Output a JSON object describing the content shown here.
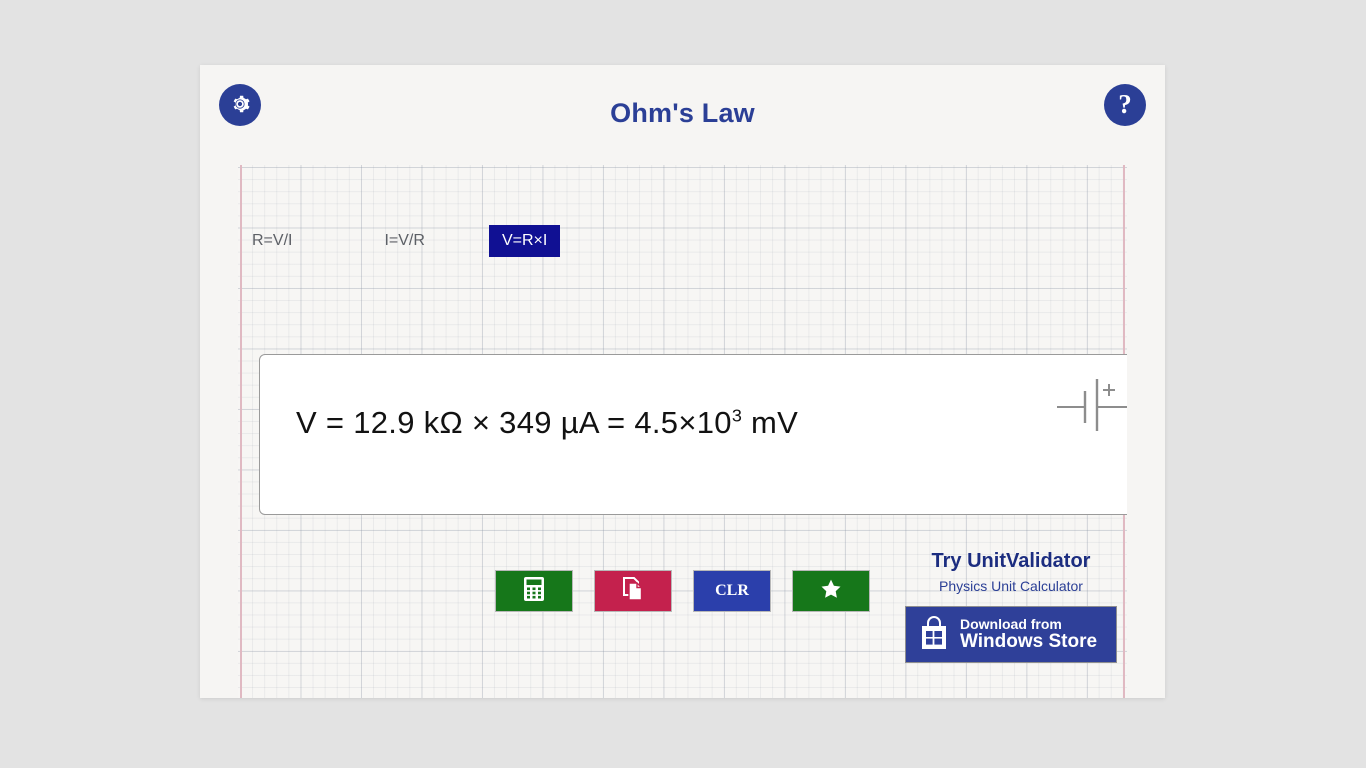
{
  "window": {
    "title": "Ohm's Law"
  },
  "header": {
    "settings_icon": "gear-icon",
    "help_icon": "question-mark-icon",
    "title": "Ohm's Law",
    "title_color": "#2b3f96"
  },
  "tabs": [
    {
      "label": "R=V/I",
      "active": false
    },
    {
      "label": "I=V/R",
      "active": false
    },
    {
      "label": "V=R×I",
      "active": true
    }
  ],
  "result": {
    "formula_prefix": "V = 12.9 kΩ × 349 µA = 4.5×10",
    "exponent": "3",
    "formula_suffix": " mV",
    "full_formula": "V = 12.9 kΩ × 349 µA = 4.5×10³ mV",
    "variable": "V",
    "resistance": "12.9 kΩ",
    "current": "349 µA",
    "voltage_result": "4.5×10³ mV",
    "status_icon": "check-mark-icon",
    "status_color": "#1a7a1f",
    "component_icon": "battery-cell-icon",
    "battery_polarity": "+"
  },
  "actions": [
    {
      "name": "calculator",
      "icon": "calculator-icon",
      "label": "",
      "color": "#16771a"
    },
    {
      "name": "copy",
      "icon": "copy-pages-icon",
      "label": "",
      "color": "#c4214d"
    },
    {
      "name": "clear",
      "icon": "",
      "label": "CLR",
      "color": "#2b3fab"
    },
    {
      "name": "favorite",
      "icon": "star-icon",
      "label": "",
      "color": "#16771a"
    }
  ],
  "promo": {
    "title": "Try UnitValidator",
    "subtitle": "Physics Unit Calculator",
    "badge_line1": "Download from",
    "badge_line2": "Windows Store",
    "badge_icon": "windows-store-bag-icon",
    "badge_color": "#2f4099"
  }
}
